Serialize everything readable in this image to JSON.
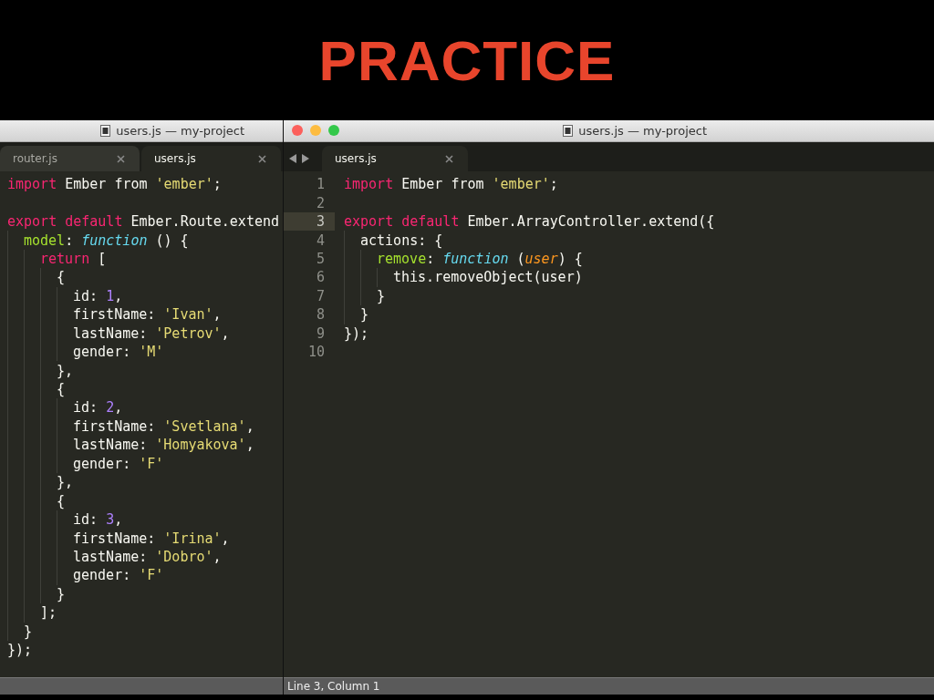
{
  "slide_title": "PRACTICE",
  "back_window": {
    "title": "users.js — my-project",
    "tabs": [
      {
        "label": "router.js",
        "selected": false
      },
      {
        "label": "users.js",
        "selected": true
      }
    ],
    "lines": [
      {
        "kind": "code",
        "tokens": [
          {
            "kind": "keyword",
            "text": "import"
          },
          {
            "kind": "plain",
            "text": " Ember from "
          },
          {
            "kind": "string",
            "text": "'ember'"
          },
          {
            "kind": "plain",
            "text": ";"
          }
        ]
      },
      {
        "kind": "blank"
      },
      {
        "kind": "code",
        "tokens": [
          {
            "kind": "keyword",
            "text": "export default"
          },
          {
            "kind": "plain",
            "text": " Ember.Route.extend"
          }
        ],
        "children": [
          {
            "kind": "code",
            "tokens": [
              {
                "kind": "property",
                "text": "model"
              },
              {
                "kind": "plain",
                "text": ": "
              },
              {
                "kind": "function",
                "text": "function"
              },
              {
                "kind": "plain",
                "text": " () {"
              }
            ],
            "children": [
              {
                "kind": "code",
                "tokens": [
                  {
                    "kind": "keyword",
                    "text": "return"
                  },
                  {
                    "kind": "plain",
                    "text": " ["
                  }
                ],
                "children": [
                  {
                    "kind": "code",
                    "tokens": [
                      {
                        "kind": "plain",
                        "text": "{"
                      }
                    ],
                    "children": [
                      {
                        "kind": "code",
                        "tokens": [
                          {
                            "kind": "plain",
                            "text": "id: "
                          },
                          {
                            "kind": "number",
                            "text": "1"
                          },
                          {
                            "kind": "plain",
                            "text": ","
                          }
                        ]
                      },
                      {
                        "kind": "code",
                        "tokens": [
                          {
                            "kind": "plain",
                            "text": "firstName: "
                          },
                          {
                            "kind": "string",
                            "text": "'Ivan'"
                          },
                          {
                            "kind": "plain",
                            "text": ","
                          }
                        ]
                      },
                      {
                        "kind": "code",
                        "tokens": [
                          {
                            "kind": "plain",
                            "text": "lastName: "
                          },
                          {
                            "kind": "string",
                            "text": "'Petrov'"
                          },
                          {
                            "kind": "plain",
                            "text": ","
                          }
                        ]
                      },
                      {
                        "kind": "code",
                        "tokens": [
                          {
                            "kind": "plain",
                            "text": "gender: "
                          },
                          {
                            "kind": "string",
                            "text": "'M'"
                          }
                        ]
                      }
                    ]
                  },
                  {
                    "kind": "code",
                    "tokens": [
                      {
                        "kind": "plain",
                        "text": "},"
                      }
                    ]
                  },
                  {
                    "kind": "code",
                    "tokens": [
                      {
                        "kind": "plain",
                        "text": "{"
                      }
                    ],
                    "children": [
                      {
                        "kind": "code",
                        "tokens": [
                          {
                            "kind": "plain",
                            "text": "id: "
                          },
                          {
                            "kind": "number",
                            "text": "2"
                          },
                          {
                            "kind": "plain",
                            "text": ","
                          }
                        ]
                      },
                      {
                        "kind": "code",
                        "tokens": [
                          {
                            "kind": "plain",
                            "text": "firstName: "
                          },
                          {
                            "kind": "string",
                            "text": "'Svetlana'"
                          },
                          {
                            "kind": "plain",
                            "text": ","
                          }
                        ]
                      },
                      {
                        "kind": "code",
                        "tokens": [
                          {
                            "kind": "plain",
                            "text": "lastName: "
                          },
                          {
                            "kind": "string",
                            "text": "'Homyakova'"
                          },
                          {
                            "kind": "plain",
                            "text": ","
                          }
                        ]
                      },
                      {
                        "kind": "code",
                        "tokens": [
                          {
                            "kind": "plain",
                            "text": "gender: "
                          },
                          {
                            "kind": "string",
                            "text": "'F'"
                          }
                        ]
                      }
                    ]
                  },
                  {
                    "kind": "code",
                    "tokens": [
                      {
                        "kind": "plain",
                        "text": "},"
                      }
                    ]
                  },
                  {
                    "kind": "code",
                    "tokens": [
                      {
                        "kind": "plain",
                        "text": "{"
                      }
                    ],
                    "children": [
                      {
                        "kind": "code",
                        "tokens": [
                          {
                            "kind": "plain",
                            "text": "id: "
                          },
                          {
                            "kind": "number",
                            "text": "3"
                          },
                          {
                            "kind": "plain",
                            "text": ","
                          }
                        ]
                      },
                      {
                        "kind": "code",
                        "tokens": [
                          {
                            "kind": "plain",
                            "text": "firstName: "
                          },
                          {
                            "kind": "string",
                            "text": "'Irina'"
                          },
                          {
                            "kind": "plain",
                            "text": ","
                          }
                        ]
                      },
                      {
                        "kind": "code",
                        "tokens": [
                          {
                            "kind": "plain",
                            "text": "lastName: "
                          },
                          {
                            "kind": "string",
                            "text": "'Dobro'"
                          },
                          {
                            "kind": "plain",
                            "text": ","
                          }
                        ]
                      },
                      {
                        "kind": "code",
                        "tokens": [
                          {
                            "kind": "plain",
                            "text": "gender: "
                          },
                          {
                            "kind": "string",
                            "text": "'F'"
                          }
                        ]
                      }
                    ]
                  },
                  {
                    "kind": "code",
                    "tokens": [
                      {
                        "kind": "plain",
                        "text": "}"
                      }
                    ]
                  }
                ]
              },
              {
                "kind": "code",
                "tokens": [
                  {
                    "kind": "plain",
                    "text": "];"
                  }
                ]
              }
            ]
          },
          {
            "kind": "code",
            "tokens": [
              {
                "kind": "plain",
                "text": "}"
              }
            ]
          }
        ]
      },
      {
        "kind": "code",
        "tokens": [
          {
            "kind": "plain",
            "text": "});"
          }
        ]
      }
    ]
  },
  "front_window": {
    "title": "users.js — my-project",
    "tabs": [
      {
        "label": "users.js",
        "selected": true
      }
    ],
    "lines": [
      {
        "number": "1",
        "current": false,
        "tokens": [
          {
            "kind": "keyword",
            "text": "import"
          },
          {
            "kind": "plain",
            "text": " Ember from "
          },
          {
            "kind": "string",
            "text": "'ember'"
          },
          {
            "kind": "plain",
            "text": ";"
          }
        ]
      },
      {
        "number": "2",
        "current": false
      },
      {
        "number": "3",
        "current": true,
        "tokens": [
          {
            "kind": "keyword",
            "text": "export default"
          },
          {
            "kind": "plain",
            "text": " Ember.ArrayController.extend({"
          }
        ],
        "children": [
          {
            "number": "4",
            "current": false,
            "tokens": [
              {
                "kind": "plain",
                "text": "actions: {"
              }
            ],
            "children": [
              {
                "number": "5",
                "current": false,
                "tokens": [
                  {
                    "kind": "property",
                    "text": "remove"
                  },
                  {
                    "kind": "plain",
                    "text": ": "
                  },
                  {
                    "kind": "function",
                    "text": "function"
                  },
                  {
                    "kind": "plain",
                    "text": " ("
                  },
                  {
                    "kind": "parameter",
                    "text": "user"
                  },
                  {
                    "kind": "plain",
                    "text": ") {"
                  }
                ],
                "children": [
                  {
                    "number": "6",
                    "current": false,
                    "tokens": [
                      {
                        "kind": "plain",
                        "text": "this.removeObject(user)"
                      }
                    ]
                  }
                ]
              },
              {
                "number": "7",
                "current": false,
                "tokens": [
                  {
                    "kind": "plain",
                    "text": "}"
                  }
                ]
              }
            ]
          },
          {
            "number": "8",
            "current": false,
            "tokens": [
              {
                "kind": "plain",
                "text": "}"
              }
            ]
          }
        ]
      },
      {
        "number": "9",
        "current": false,
        "tokens": [
          {
            "kind": "plain",
            "text": "});"
          }
        ]
      },
      {
        "number": "10",
        "current": false
      }
    ],
    "status_bar": "Line 3, Column 1"
  }
}
